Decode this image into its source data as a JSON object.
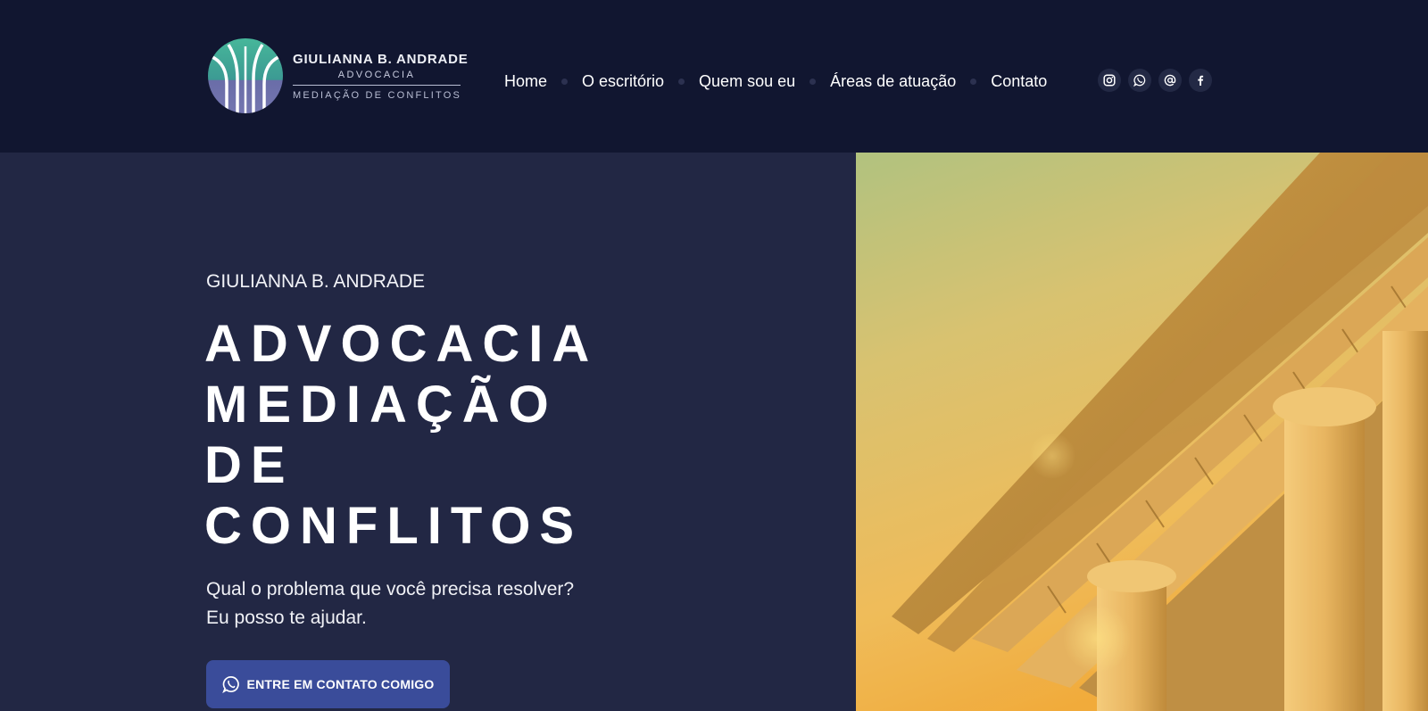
{
  "brand": {
    "name": "GIULIANNA B. ANDRADE",
    "subtitle": "ADVOCACIA",
    "tagline": "MEDIAÇÃO DE CONFLITOS",
    "colors": {
      "teal": "#3fae9a",
      "purple": "#6e6ea8",
      "navy": "#111630"
    }
  },
  "nav": {
    "items": [
      {
        "label": "Home"
      },
      {
        "label": "O escritório"
      },
      {
        "label": "Quem sou eu"
      },
      {
        "label": "Áreas de atuação"
      },
      {
        "label": "Contato"
      }
    ]
  },
  "social": [
    {
      "icon": "instagram-icon"
    },
    {
      "icon": "whatsapp-icon"
    },
    {
      "icon": "email-at-icon"
    },
    {
      "icon": "facebook-icon"
    }
  ],
  "hero": {
    "eyebrow": "GIULIANNA B. ANDRADE",
    "title_lines": [
      "ADVOCACIA",
      "MEDIAÇÃO",
      "DE",
      "CONFLITOS"
    ],
    "description_lines": [
      "Qual o problema que você precisa resolver?",
      "Eu posso te ajudar."
    ],
    "cta_label": "ENTRE EM CONTATO COMIGO",
    "cta_icon": "whatsapp-icon",
    "image": "courthouse-columns-photo",
    "colors": {
      "background": "#222744",
      "cta": "#3a4c9a",
      "image_tint": "#f0b548"
    }
  }
}
